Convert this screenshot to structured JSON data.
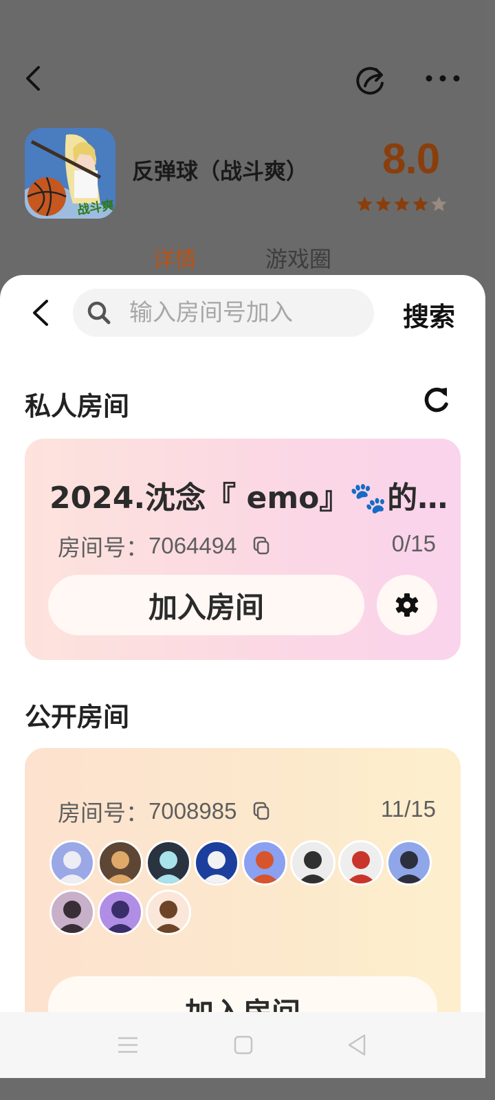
{
  "header": {
    "game_title": "反弹球（战斗爽）",
    "game_icon_text": "战斗爽",
    "score": "8.0",
    "rating_stars": 4,
    "rating_max": 5,
    "tabs": [
      {
        "label": "详情",
        "active": true
      },
      {
        "label": "游戏圈",
        "active": false
      }
    ]
  },
  "search": {
    "placeholder": "输入房间号加入",
    "value": "",
    "button_label": "搜索"
  },
  "private_rooms": {
    "title": "私人房间",
    "room": {
      "name": "2024.沈念『 emo』🐾的…",
      "id_label": "房间号：",
      "id": "7064494",
      "count": "0/15",
      "join_label": "加入房间"
    }
  },
  "public_rooms": {
    "title": "公开房间",
    "room": {
      "id_label": "房间号：",
      "id": "7008985",
      "count": "11/15",
      "join_label": "加入房间",
      "avatar_count": 11
    }
  },
  "colors": {
    "accent": "#b4541a",
    "score": "#8a3e0c",
    "star": "#8a3e0c",
    "star_empty": "#9a8a80"
  }
}
